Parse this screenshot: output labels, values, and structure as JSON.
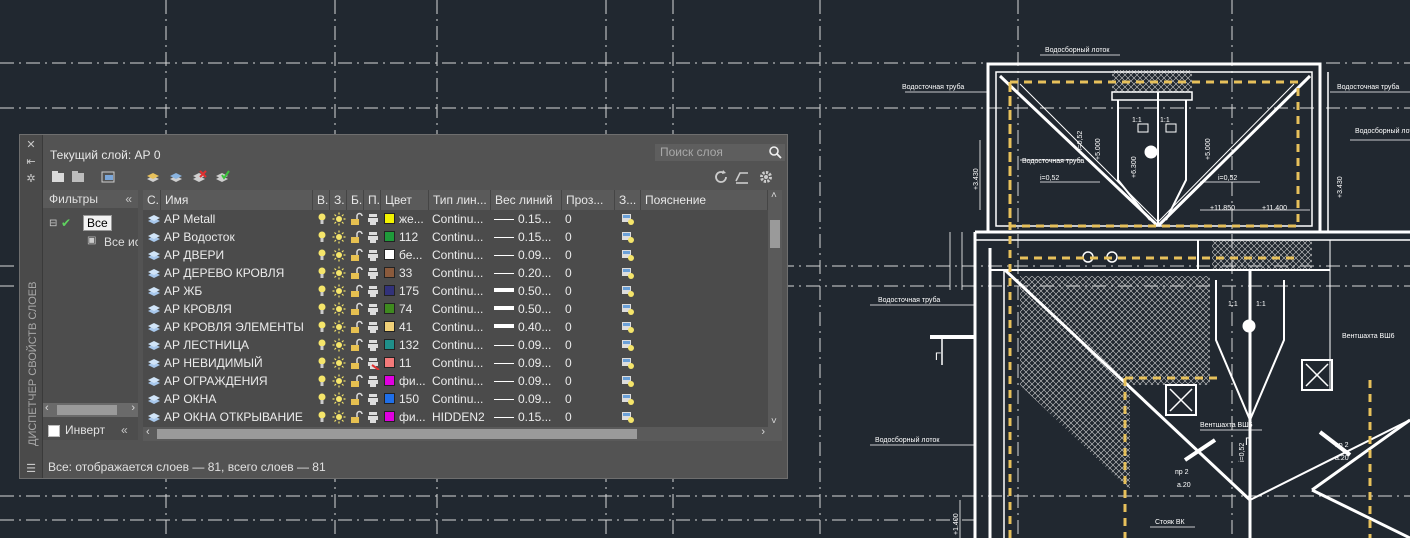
{
  "drawing": {
    "labels": {
      "vodosb_lotok_top": "Водосборный лоток",
      "vodost_truba_left": "Водосточная труба",
      "vodost_truba_right": "Водосточная труба",
      "vodosb_lotok_right": "Водосборный лоток",
      "vodosb_lotok_mid": "Водосборный лоток",
      "vodost_truba_mid": "Водосточная труба",
      "vodost_truba_inner": "Водосточная труба",
      "elev_3430_left": "+3.430",
      "elev_3430_right": "+3.430",
      "elev_5000_a": "+5.000",
      "elev_5000_b": "+5.000",
      "elev_6300": "+6.300",
      "elev_11850": "+11.850",
      "elev_11400": "+11.400",
      "elev_1400": "+1.400",
      "slope_a": "i=0,52",
      "slope_b": "i=0,52",
      "slope_c": "i=0,52",
      "slope_d": "i=0,52",
      "ratio_a": "1:1",
      "ratio_b": "1:1",
      "ratio_c": "1:1",
      "ratio_d": "1:1",
      "vent_a": "Вентшахта ВШ6",
      "vent_b": "Вентшахта ВШ6",
      "section_g1": "Г",
      "section_g2": "Г",
      "pp2_a": "пр 2",
      "pp2_b": "пр 2",
      "a20_a": "а.20",
      "a20_b": "а.20",
      "stoyak": "Стояк ВК"
    },
    "colors": {
      "background": "#212830",
      "lines": "#ffffff",
      "accent": "#e7c15b"
    }
  },
  "palette": {
    "side_title": "ДИСПЕТЧЕР СВОЙСТВ СЛОЕВ",
    "current_layer": "Текущий слой: АР 0",
    "search_placeholder": "Поиск слоя",
    "filters_title": "Фильтры",
    "filters_tree": {
      "root": "Все",
      "child": "Все ис"
    },
    "invert_label": "Инверт",
    "columns": [
      "С.",
      "Имя",
      "В.",
      "З.",
      "Б.",
      "П.",
      "Цвет",
      "Тип лин...",
      "Вес линий",
      "Проз...",
      "З...",
      "Пояснение"
    ],
    "layers": [
      {
        "name": "АР Metall",
        "color_hex": "#f3f300",
        "color": "же...",
        "linetype": "Continu...",
        "lineweight": "0.15...",
        "lw_level": 1,
        "transparency": "0"
      },
      {
        "name": "АР Водосток",
        "color_hex": "#1f9a3a",
        "color": "112",
        "linetype": "Continu...",
        "lineweight": "0.15...",
        "lw_level": 1,
        "transparency": "0"
      },
      {
        "name": "АР ДВЕРИ",
        "color_hex": "#ffffff",
        "color": "бе...",
        "linetype": "Continu...",
        "lineweight": "0.09...",
        "lw_level": 1,
        "transparency": "0"
      },
      {
        "name": "АР ДЕРЕВО КРОВЛЯ",
        "color_hex": "#8a5a3c",
        "color": "33",
        "linetype": "Continu...",
        "lineweight": "0.20...",
        "lw_level": 1,
        "transparency": "0"
      },
      {
        "name": "АР ЖБ",
        "color_hex": "#32327a",
        "color": "175",
        "linetype": "Continu...",
        "lineweight": "0.50...",
        "lw_level": 4,
        "transparency": "0"
      },
      {
        "name": "АР КРОВЛЯ",
        "color_hex": "#3f8a1f",
        "color": "74",
        "linetype": "Continu...",
        "lineweight": "0.50...",
        "lw_level": 4,
        "transparency": "0"
      },
      {
        "name": "АР КРОВЛЯ ЭЛЕМЕНТЫ",
        "color_hex": "#f0d078",
        "color": "41",
        "linetype": "Continu...",
        "lineweight": "0.40...",
        "lw_level": 3,
        "transparency": "0"
      },
      {
        "name": "АР ЛЕСТНИЦА",
        "color_hex": "#1f8f8a",
        "color": "132",
        "linetype": "Continu...",
        "lineweight": "0.09...",
        "lw_level": 1,
        "transparency": "0"
      },
      {
        "name": "АР НЕВИДИМЫЙ",
        "color_hex": "#f47a7a",
        "color": "11",
        "linetype": "Continu...",
        "lineweight": "0.09...",
        "lw_level": 1,
        "transparency": "0"
      },
      {
        "name": "АР ОГРАЖДЕНИЯ",
        "color_hex": "#e000e0",
        "color": "фи...",
        "linetype": "Continu...",
        "lineweight": "0.09...",
        "lw_level": 1,
        "transparency": "0"
      },
      {
        "name": "АР ОКНА",
        "color_hex": "#1f6fe8",
        "color": "150",
        "linetype": "Continu...",
        "lineweight": "0.09...",
        "lw_level": 1,
        "transparency": "0"
      },
      {
        "name": "АР ОКНА ОТКРЫВАНИЕ",
        "color_hex": "#e000e0",
        "color": "фи...",
        "linetype": "HIDDEN2",
        "lineweight": "0.15...",
        "lw_level": 1,
        "transparency": "0"
      }
    ],
    "status": "Все: отображается слоев — 81, всего слоев — 81"
  }
}
